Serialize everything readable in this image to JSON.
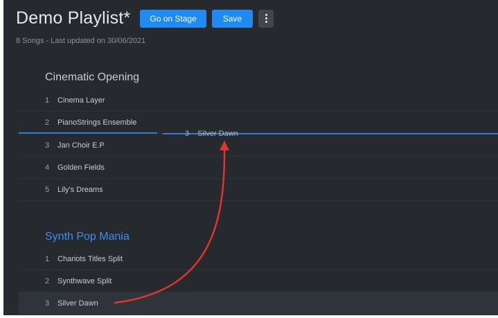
{
  "header": {
    "title": "Demo Playlist*",
    "go_on_stage_label": "Go on Stage",
    "save_label": "Save",
    "subtitle": "8 Songs - Last updated on 30/06/2021"
  },
  "groups": [
    {
      "title": "Cinematic Opening",
      "songs": [
        {
          "num": "1",
          "name": "Cinema Layer"
        },
        {
          "num": "2",
          "name": "PianoStrings Ensemble"
        },
        {
          "num": "3",
          "name": "Jan Choir E.P"
        },
        {
          "num": "4",
          "name": "Golden Fields"
        },
        {
          "num": "5",
          "name": "Lily's Dreams"
        }
      ]
    },
    {
      "title": "Synth Pop Mania",
      "songs": [
        {
          "num": "1",
          "name": "Chariots Titles Split"
        },
        {
          "num": "2",
          "name": "Synthwave Split"
        },
        {
          "num": "3",
          "name": "Silver Dawn"
        }
      ]
    }
  ],
  "drag_ghost": {
    "num": "3",
    "name": "Silver Dawn"
  },
  "colors": {
    "background": "#262a2f",
    "accent": "#1f8bf2",
    "active_group_title": "#3a8ff0",
    "drop_indicator": "#2f7fd9",
    "annotation_arrow": "#e0352b"
  },
  "icons": {
    "more": "vertical-ellipsis-icon"
  }
}
